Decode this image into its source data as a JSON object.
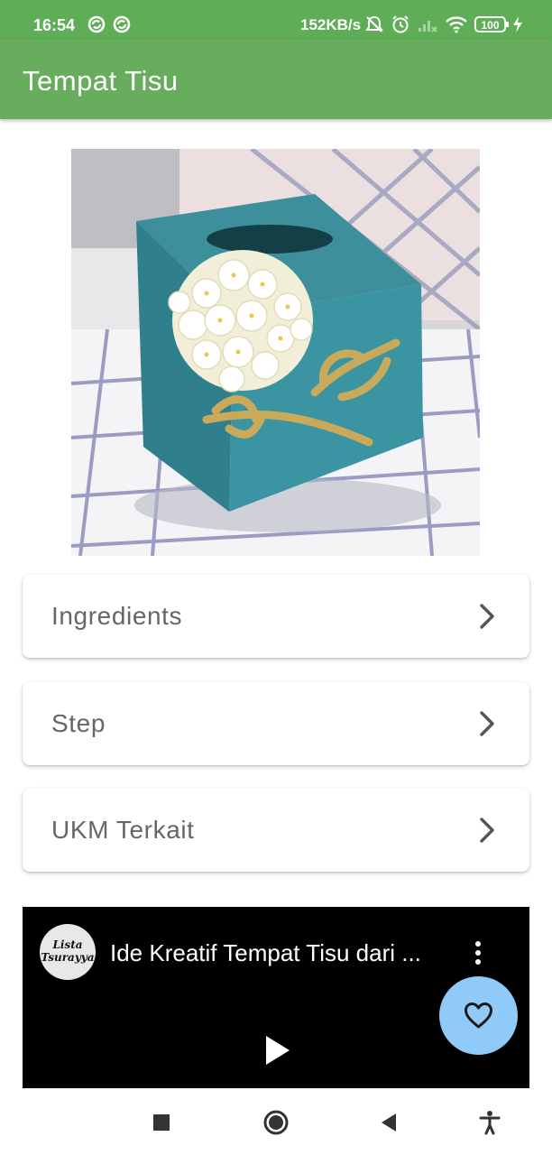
{
  "status_bar": {
    "time": "16:54",
    "network_speed": "152KB/s",
    "battery_level": "100",
    "icons": [
      "sync-icon",
      "sync-icon",
      "mute-icon",
      "alarm-icon",
      "signal-icon",
      "wifi-icon",
      "battery-icon",
      "charging-icon"
    ]
  },
  "app_bar": {
    "title": "Tempat Tisu"
  },
  "hero_image": {
    "description_icon": "tissue-box-photo"
  },
  "menu": {
    "items": [
      {
        "label": "Ingredients",
        "icon": "chevron-right-icon"
      },
      {
        "label": "Step",
        "icon": "chevron-right-icon"
      },
      {
        "label": "UKM Terkait",
        "icon": "chevron-right-icon"
      }
    ]
  },
  "video": {
    "channel_logo_text": "Lista Tsurayya",
    "title": "Ide Kreatif Tempat Tisu dari ...",
    "more_icon": "more-vertical-icon",
    "play_icon": "play-icon"
  },
  "fab": {
    "icon": "heart-outline-icon"
  },
  "nav_bar": {
    "items": [
      "recents-icon",
      "home-icon",
      "back-icon",
      "accessibility-icon"
    ]
  },
  "colors": {
    "status_bar": "#5fae57",
    "app_bar": "#68ad5e",
    "fab": "#90caf9",
    "card_text": "#666666"
  }
}
